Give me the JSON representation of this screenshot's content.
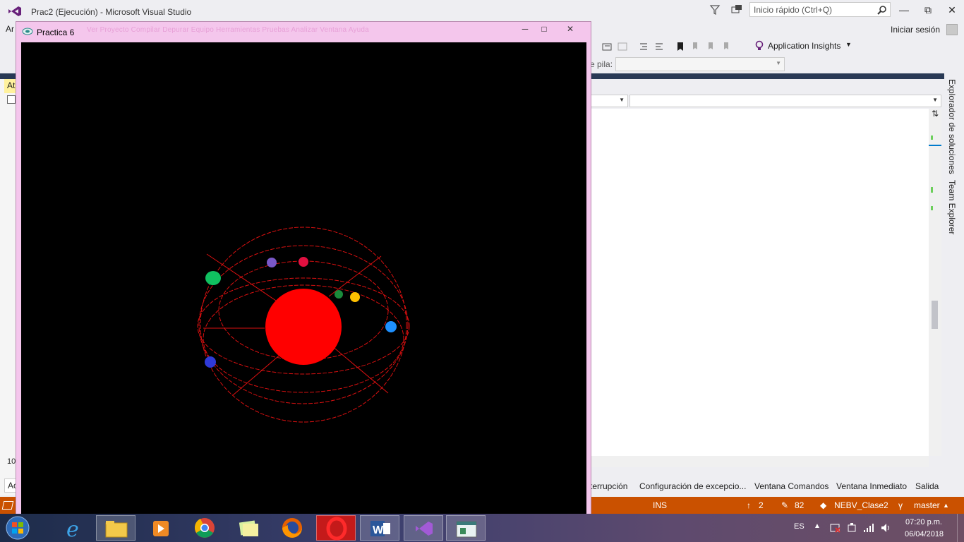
{
  "vs": {
    "title": "Prac2 (Ejecución) - Microsoft Visual Studio",
    "quick_launch_placeholder": "Inicio rápido (Ctrl+Q)",
    "menu_fragment": "Ar",
    "signin": "Iniciar sesión",
    "application_insights": "Application Insights",
    "stack_label": "e pila:",
    "vtabs": [
      "Explorador de soluciones",
      "Team Explorer"
    ],
    "left_at": "At",
    "left_num": "10",
    "left_ac": "Ac",
    "bottom_tabs": [
      "terrupción",
      "Configuración de excepcio...",
      "Ventana Comandos",
      "Ventana Inmediato",
      "Salida"
    ],
    "status": {
      "mode": "INS",
      "up_count": "2",
      "edit_count": "82",
      "repo": "NEBV_Clase2",
      "branch": "master"
    }
  },
  "glut": {
    "title": "Practica 6",
    "ghost_menu": "Ver   Proyecto   Compilar   Depurar   Equipo   Herramientas   Pruebas   Analizar   Ventana   Ayuda"
  },
  "taskbar": {
    "lang": "ES",
    "time": "07:20 p.m.",
    "date": "06/04/2018"
  },
  "colors": {
    "status_bar": "#ca5100",
    "sun": "#ff0000",
    "orbit": "#d91010"
  },
  "icons": {
    "vs_logo": "visual-studio-icon",
    "filter": "filter-icon",
    "feedback": "feedback-icon",
    "search": "search-icon",
    "start": "windows-start-icon"
  }
}
